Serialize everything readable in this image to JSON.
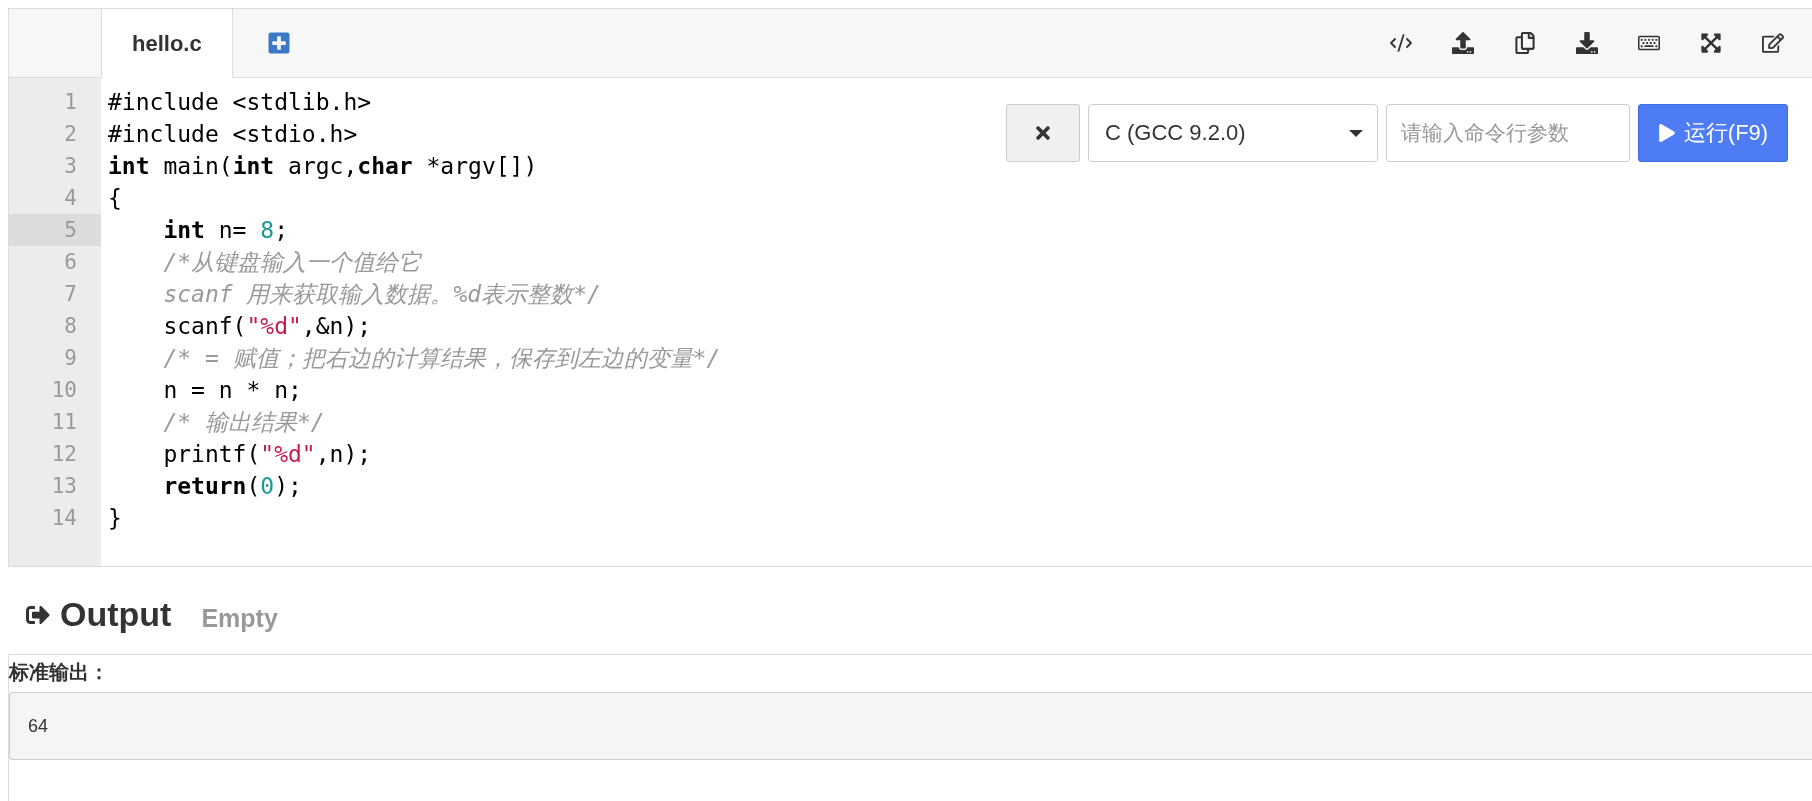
{
  "tabs": [
    {
      "label": "hello.c",
      "selected": true
    }
  ],
  "editor": {
    "lines": [
      {
        "number": "1",
        "active": false,
        "indented": false,
        "tokens": [
          {
            "kind": "plain",
            "text": "#include <stdlib.h>"
          }
        ]
      },
      {
        "number": "2",
        "active": false,
        "indented": false,
        "tokens": [
          {
            "kind": "plain",
            "text": "#include <stdio.h>"
          }
        ]
      },
      {
        "number": "3",
        "active": false,
        "indented": false,
        "tokens": [
          {
            "kind": "keyword",
            "text": "int"
          },
          {
            "kind": "plain",
            "text": " main("
          },
          {
            "kind": "keyword",
            "text": "int"
          },
          {
            "kind": "plain",
            "text": " argc,"
          },
          {
            "kind": "keyword",
            "text": "char"
          },
          {
            "kind": "plain",
            "text": " *argv[])"
          }
        ]
      },
      {
        "number": "4",
        "active": false,
        "indented": false,
        "tokens": [
          {
            "kind": "plain",
            "text": "{"
          }
        ]
      },
      {
        "number": "5",
        "active": true,
        "indented": true,
        "tokens": [
          {
            "kind": "keyword",
            "text": "int"
          },
          {
            "kind": "plain",
            "text": " n= "
          },
          {
            "kind": "number",
            "text": "8"
          },
          {
            "kind": "plain",
            "text": ";"
          }
        ]
      },
      {
        "number": "6",
        "active": false,
        "indented": true,
        "tokens": [
          {
            "kind": "comment",
            "text": "/*从键盘输入一个值给它"
          }
        ]
      },
      {
        "number": "7",
        "active": false,
        "indented": true,
        "tokens": [
          {
            "kind": "comment",
            "text": "scanf 用来获取输入数据。%d表示整数*/"
          }
        ]
      },
      {
        "number": "8",
        "active": false,
        "indented": true,
        "tokens": [
          {
            "kind": "plain",
            "text": "scanf("
          },
          {
            "kind": "string",
            "text": "\"%d\""
          },
          {
            "kind": "plain",
            "text": ",&n);"
          }
        ]
      },
      {
        "number": "9",
        "active": false,
        "indented": true,
        "tokens": [
          {
            "kind": "comment",
            "text": "/* = 赋值；把右边的计算结果，保存到左边的变量*/"
          }
        ]
      },
      {
        "number": "10",
        "active": false,
        "indented": true,
        "tokens": [
          {
            "kind": "plain",
            "text": "n = n * n;"
          }
        ]
      },
      {
        "number": "11",
        "active": false,
        "indented": true,
        "tokens": [
          {
            "kind": "comment",
            "text": "/* 输出结果*/"
          }
        ]
      },
      {
        "number": "12",
        "active": false,
        "indented": true,
        "tokens": [
          {
            "kind": "plain",
            "text": "printf("
          },
          {
            "kind": "string",
            "text": "\"%d\""
          },
          {
            "kind": "plain",
            "text": ",n);"
          }
        ]
      },
      {
        "number": "13",
        "active": false,
        "indented": true,
        "tokens": [
          {
            "kind": "keyword",
            "text": "return"
          },
          {
            "kind": "plain",
            "text": "("
          },
          {
            "kind": "number",
            "text": "0"
          },
          {
            "kind": "plain",
            "text": ");"
          }
        ]
      },
      {
        "number": "14",
        "active": false,
        "indented": false,
        "tokens": [
          {
            "kind": "plain",
            "text": "}"
          }
        ]
      }
    ]
  },
  "run_bar": {
    "language": "C (GCC 9.2.0)",
    "args_placeholder": "请输入命令行参数",
    "run_label": "运行(F9)"
  },
  "output": {
    "title": "Output",
    "status": "Empty",
    "stdout_label": "标准输出：",
    "stdout": "64"
  }
}
